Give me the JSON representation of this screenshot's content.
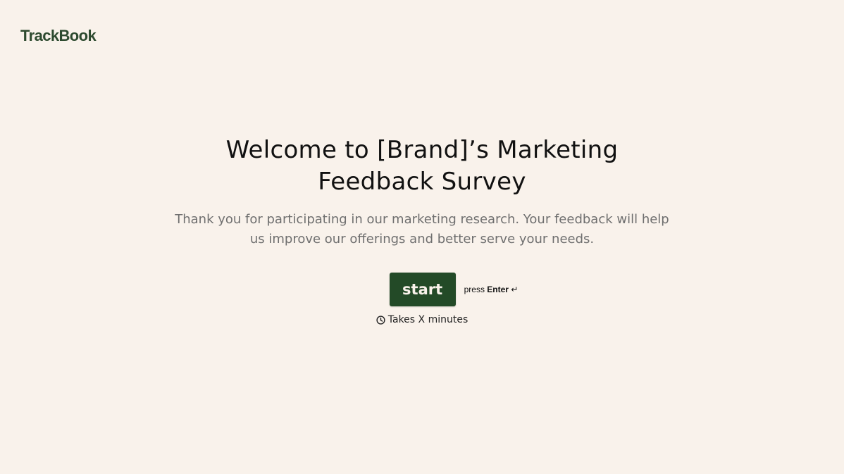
{
  "brand": {
    "logo_text": "TrackBook",
    "color": "#2d4a2f"
  },
  "welcome": {
    "title": "Welcome to [Brand]’s Marketing Feedback Survey",
    "description": "Thank you for participating in our marketing research. Your feedback will help us improve our offerings and better serve your needs."
  },
  "actions": {
    "start_label": "start",
    "hint_prefix": "press",
    "hint_key": "Enter",
    "hint_icon": "return-key-icon",
    "hint_glyph": "↵"
  },
  "meta": {
    "duration_icon": "clock-icon",
    "duration_text": "Takes X minutes"
  },
  "colors": {
    "background": "#f9f2eb",
    "button": "#234a27",
    "button_text": "#f9f2eb",
    "description_text": "#6f6f6f"
  }
}
